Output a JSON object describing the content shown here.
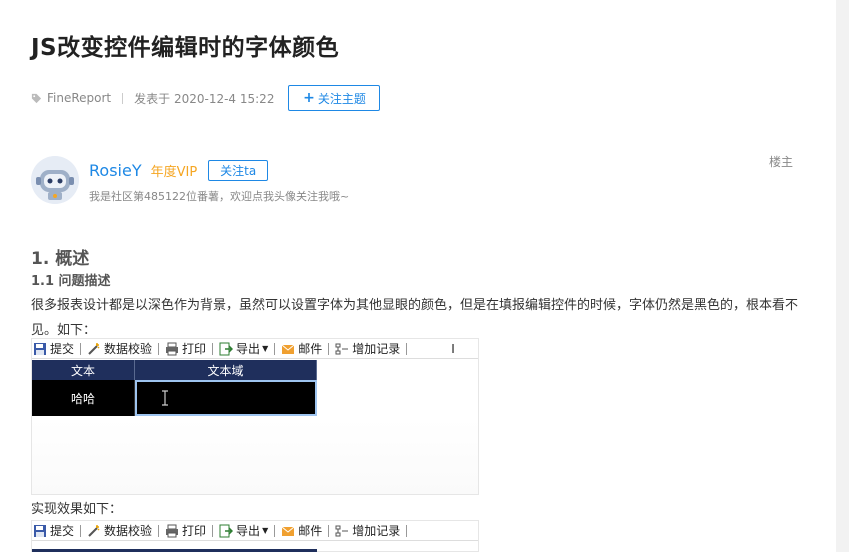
{
  "post": {
    "title": "JS改变控件编辑时的字体颜色",
    "category": "FineReport",
    "posted_at": "发表于 2020-12-4 15:22",
    "follow_topic_label": "关注主题"
  },
  "author": {
    "name": "RosieY",
    "vip_label": "年度VIP",
    "follow_label": "关注ta",
    "signature": "我是社区第485122位番薯，欢迎点我头像关注我哦~",
    "floor_label": "楼主"
  },
  "content": {
    "heading1": "1. 概述",
    "heading2": "1.1 问题描述",
    "paragraph": "很多报表设计都是以深色作为背景，虽然可以设置字体为其他显眼的颜色，但是在填报编辑控件的时候，字体仍然是黑色的，根本看不见。如下：",
    "caption_result": "实现效果如下："
  },
  "embedded_toolbar": {
    "items": [
      "提交",
      "数据校验",
      "打印",
      "导出",
      "邮件",
      "增加记录"
    ],
    "trailing_glyph": "I"
  },
  "embedded_grid": {
    "headers": [
      "文本",
      "文本域"
    ],
    "row_value": "哈哈"
  },
  "colors": {
    "accent": "#1e88e5",
    "vip": "#f5a623",
    "grid_header_bg": "#1f2f5c",
    "grid_cell_bg": "#000000"
  }
}
